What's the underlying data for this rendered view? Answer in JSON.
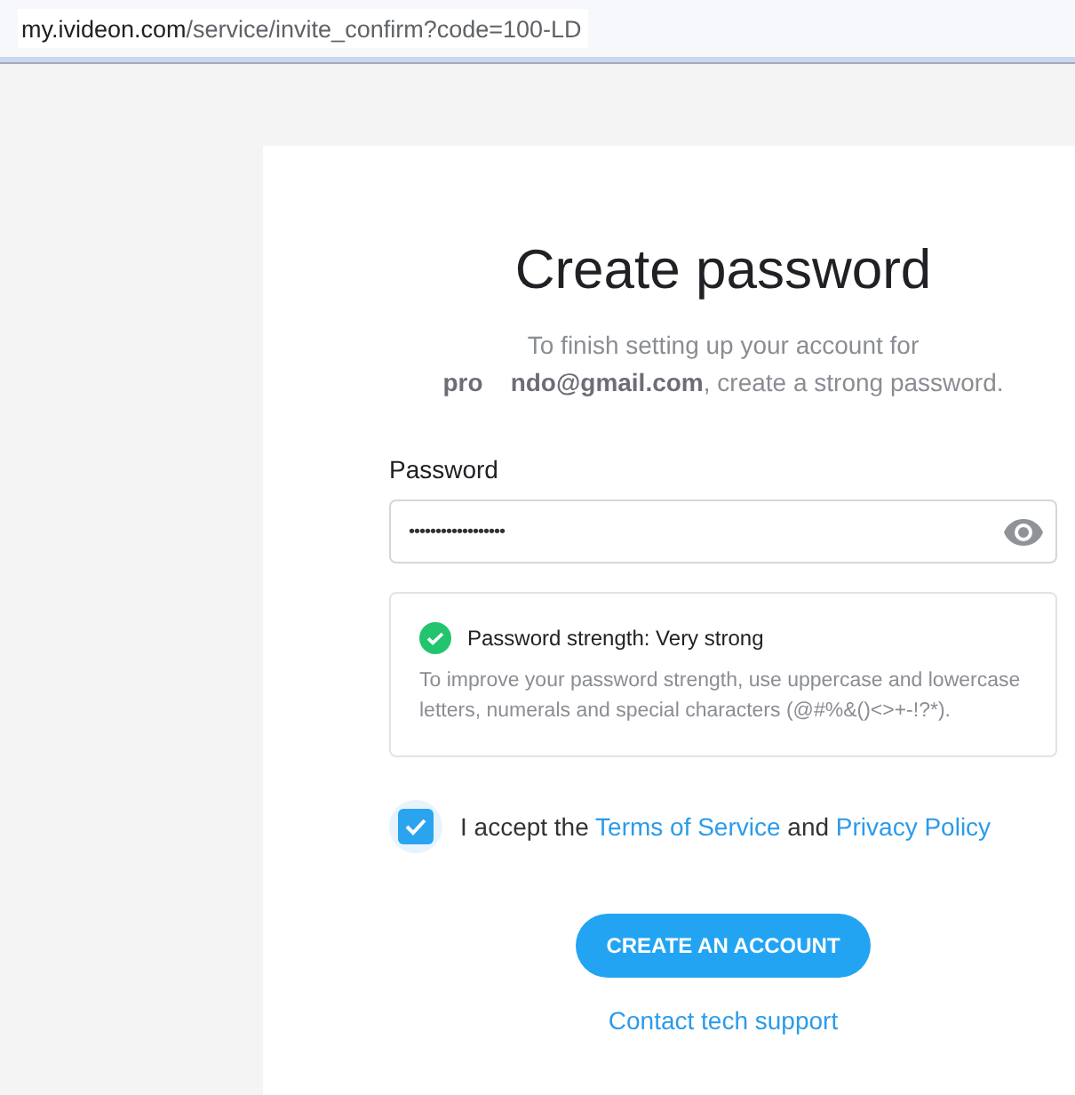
{
  "address_bar": {
    "host": "my.ivideon.com",
    "path": "/service/invite_confirm?code=100-LD"
  },
  "title": "Create password",
  "intro": "To finish setting up your account for **pro    ndo@gmail.com**, create a strong password.",
  "password": {
    "label": "Password",
    "value": "••••••••••••••••••"
  },
  "strength": {
    "ok": true,
    "title": "Password strength: Very strong",
    "hint": "To improve your password strength, use uppercase and lowercase letters, numerals and special characters (@#%&()<>+-!?*)."
  },
  "consent": {
    "checked": true,
    "lead": "I accept the",
    "terms": "Terms of Service",
    "joiner": "and",
    "privacy": "Privacy Policy"
  },
  "submit": "CREATE AN ACCOUNT",
  "support_link": "Contact tech support"
}
